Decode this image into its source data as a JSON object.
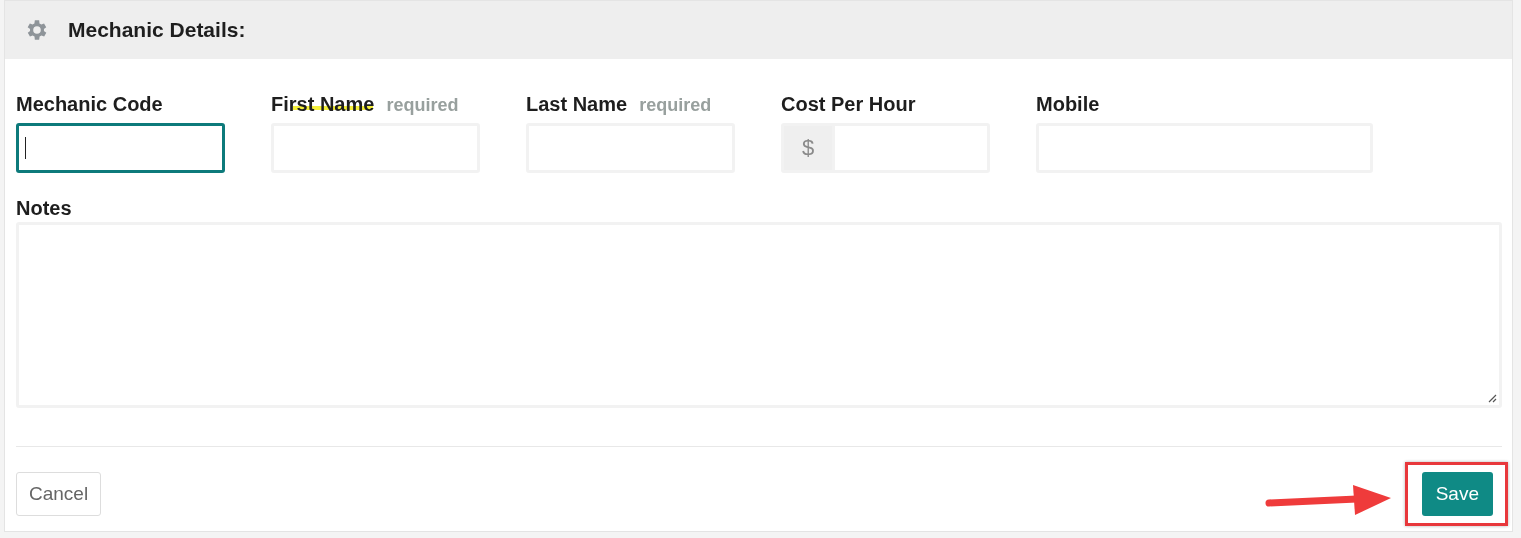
{
  "panel": {
    "title": "Mechanic Details:"
  },
  "fields": [
    {
      "kind": "text",
      "label": "Mechanic Code",
      "focused": true,
      "highlighted": false
    },
    {
      "kind": "text",
      "label": "First Name",
      "required": "required",
      "focused": false,
      "highlighted": true
    },
    {
      "kind": "text",
      "label": "Last Name",
      "required": "required",
      "focused": false,
      "highlighted": false
    },
    {
      "kind": "currency",
      "label": "Cost Per Hour",
      "prefix": "$",
      "focused": false,
      "highlighted": false
    },
    {
      "kind": "wide",
      "label": "Mobile",
      "focused": false,
      "highlighted": false
    }
  ],
  "notes": {
    "label": "Notes"
  },
  "buttons": {
    "cancel": "Cancel",
    "save": "Save"
  },
  "callout": {
    "arrow": true,
    "outline": true
  }
}
